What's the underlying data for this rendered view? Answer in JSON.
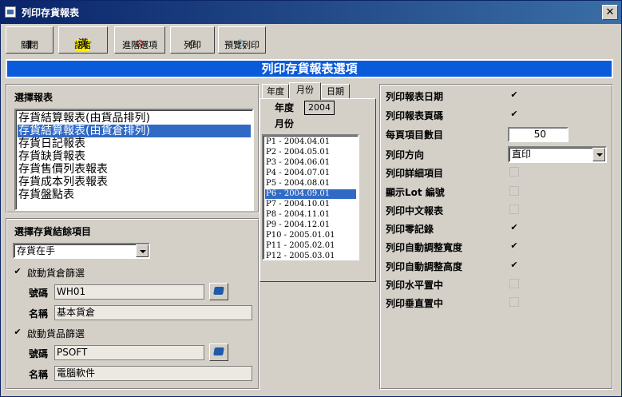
{
  "window": {
    "title": "列印存貨報表",
    "close": "✕"
  },
  "toolbar": {
    "close": {
      "label": "關閉",
      "icon": "▮"
    },
    "language": {
      "label": "語言",
      "icon": "漢"
    },
    "advanced": {
      "label": "進階選項",
      "icon": "⚙"
    },
    "print": {
      "label": "列印",
      "icon": "⎙"
    },
    "preview": {
      "label": "預覽列印",
      "icon": "🔍"
    }
  },
  "banner": "列印存貨報表選項",
  "reports": {
    "title": "選擇報表",
    "items": [
      "存貨結算報表(由貨品排列)",
      "存貨結算報表(由貨倉排列)",
      "存貨日記報表",
      "存貨缺貨報表",
      "存貨售價列表報表",
      "存貨成本列表報表",
      "存貨盤點表"
    ],
    "selected_index": 1
  },
  "balance": {
    "title": "選擇存貨結餘項目",
    "combo_value": "存貨在手",
    "warehouse_filter": {
      "label": "啟動貨倉篩選",
      "checked": true,
      "code_label": "號碼",
      "code": "WH01",
      "name_label": "名稱",
      "name": "基本貨倉"
    },
    "product_filter": {
      "label": "啟動貨品篩選",
      "checked": true,
      "code_label": "號碼",
      "code": "PSOFT",
      "name_label": "名稱",
      "name": "電腦軟件"
    }
  },
  "period": {
    "tabs": [
      "年度",
      "月份",
      "日期"
    ],
    "active_tab": 1,
    "year_label": "年度",
    "year": "2004",
    "month_label": "月份",
    "months": [
      "P1 - 2004.04.01",
      "P2 - 2004.05.01",
      "P3 - 2004.06.01",
      "P4 - 2004.07.01",
      "P5 - 2004.08.01",
      "P6 - 2004.09.01",
      "P7 - 2004.10.01",
      "P8 - 2004.11.01",
      "P9 - 2004.12.01",
      "P10 - 2005.01.01",
      "P11 - 2005.02.01",
      "P12 - 2005.03.01"
    ],
    "selected_index": 5
  },
  "options": {
    "print_date": {
      "label": "列印報表日期",
      "checked": true
    },
    "print_page": {
      "label": "列印報表頁碼",
      "checked": true
    },
    "items_per_page": {
      "label": "每頁項目數目",
      "value": "50"
    },
    "orientation": {
      "label": "列印方向",
      "value": "直印"
    },
    "detail": {
      "label": "列印詳細項目",
      "checked": false
    },
    "lot": {
      "label": "顯示Lot 編號",
      "checked": false
    },
    "chinese": {
      "label": "列印中文報表",
      "checked": false
    },
    "zero": {
      "label": "列印零記錄",
      "checked": true
    },
    "auto_width": {
      "label": "列印自動調整寬度",
      "checked": true
    },
    "auto_height": {
      "label": "列印自動調整高度",
      "checked": true
    },
    "h_center": {
      "label": "列印水平置中",
      "checked": false
    },
    "v_center": {
      "label": "列印垂直置中",
      "checked": false
    }
  }
}
